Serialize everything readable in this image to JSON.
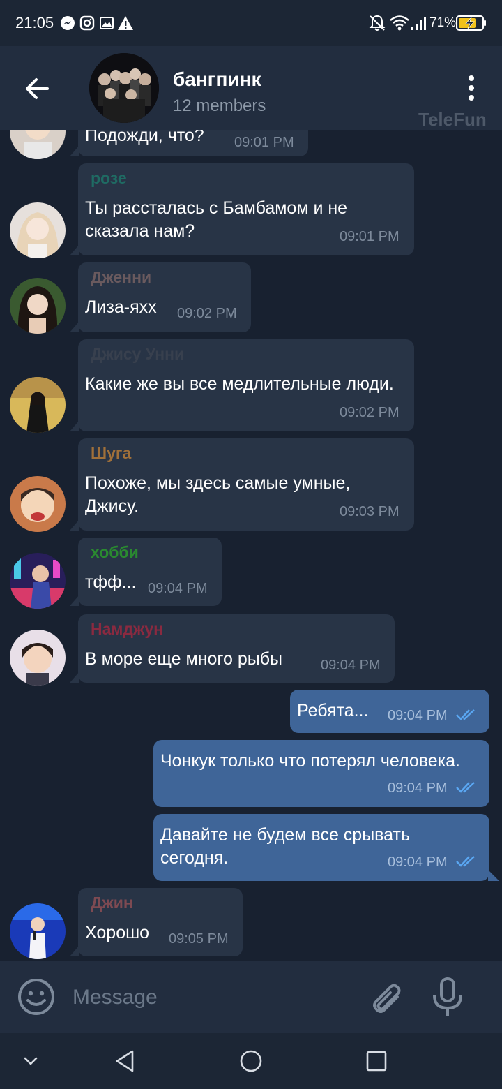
{
  "status_bar": {
    "time": "21:05",
    "battery": "71%",
    "icons": [
      "messenger-icon",
      "instagram-icon",
      "gallery-icon",
      "warning-icon",
      "mute-bell-icon",
      "wifi-icon",
      "signal-icon",
      "battery-charging-icon"
    ]
  },
  "header": {
    "title": "бангпинк",
    "subtitle": "12 members",
    "watermark": "TeleFun"
  },
  "messages": [
    {
      "id": "m0",
      "direction": "in",
      "sender": "",
      "text": "Подожди, что?",
      "time": "09:01 PM"
    },
    {
      "id": "m1",
      "direction": "in",
      "sender": "розе",
      "sender_color": "#1f6b63",
      "text": "Ты рассталась с Бамбамом и не сказала нам?",
      "time": "09:01 PM"
    },
    {
      "id": "m2",
      "direction": "in",
      "sender": "Дженни",
      "sender_color": "#6a5a5e",
      "text": "Лиза-яхх",
      "time": "09:02 PM"
    },
    {
      "id": "m3",
      "direction": "in",
      "sender": "Джису Унни",
      "sender_color": "#38404e",
      "text": "Какие же вы все медлительные люди.",
      "time": "09:02 PM"
    },
    {
      "id": "m4",
      "direction": "in",
      "sender": "Шуга",
      "sender_color": "#a0703a",
      "text": "Похоже, мы здесь самые умные, Джису.",
      "time": "09:03 PM"
    },
    {
      "id": "m5",
      "direction": "in",
      "sender": "хобби",
      "sender_color": "#2a8a30",
      "text": "тфф...",
      "time": "09:04 PM"
    },
    {
      "id": "m6",
      "direction": "in",
      "sender": "Намджун",
      "sender_color": "#8a2a40",
      "text": "В море еще много рыбы",
      "time": "09:04 PM"
    },
    {
      "id": "m7",
      "direction": "out",
      "text": "Ребята...",
      "time": "09:04 PM",
      "read": true
    },
    {
      "id": "m8",
      "direction": "out",
      "text": "Чонкук только что потерял человека.",
      "time": "09:04 PM",
      "read": true
    },
    {
      "id": "m9",
      "direction": "out",
      "text": "Давайте не будем все срывать сегодня.",
      "time": "09:04 PM",
      "read": true
    },
    {
      "id": "m10",
      "direction": "in",
      "sender": "Джин",
      "sender_color": "#7e4a52",
      "text": "Хорошо",
      "time": "09:05 PM"
    }
  ],
  "input": {
    "placeholder": "Message"
  },
  "colors": {
    "background": "#182130",
    "header": "#222d3f",
    "incoming_bubble": "#283446",
    "outgoing_bubble": "#3f6598",
    "read_ticks": "#5aa7f2"
  }
}
